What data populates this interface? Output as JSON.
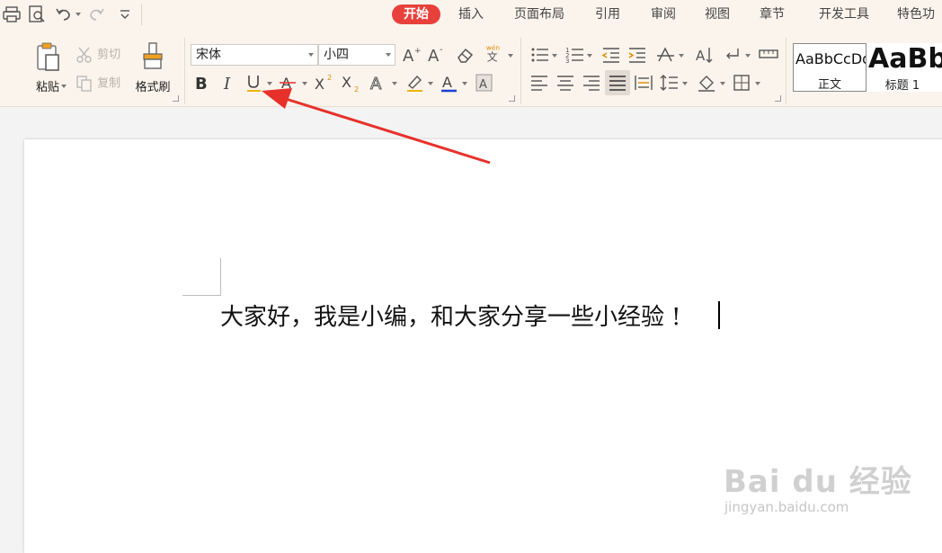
{
  "tabs": [
    {
      "label": "开始",
      "active": true
    },
    {
      "label": "插入"
    },
    {
      "label": "页面布局"
    },
    {
      "label": "引用"
    },
    {
      "label": "审阅"
    },
    {
      "label": "视图"
    },
    {
      "label": "章节"
    },
    {
      "label": "开发工具"
    },
    {
      "label": "特色功"
    }
  ],
  "clipboard": {
    "paste_label": "粘贴",
    "cut_label": "剪切",
    "copy_label": "复制",
    "format_painter_label": "格式刷"
  },
  "font": {
    "family_value": "宋体",
    "size_value": "小四"
  },
  "styles": {
    "normal_preview": "AaBbCcDd",
    "normal_name": "正文",
    "heading1_preview": "AaBb",
    "heading1_name": "标题 1"
  },
  "phonetic_glyph": "wén",
  "document": {
    "body_text": "大家好，我是小编，和大家分享一些小经验",
    "trailing_text": "!"
  },
  "watermark": {
    "logo_text": "Bai du 经验",
    "url_text": "jingyan.baidu.com"
  },
  "colors": {
    "active_tab": "#e8413b",
    "ribbon_bg": "#fbf4ec",
    "arrow": "#e8302a",
    "underline_accent": "#f0b400",
    "font_color_bar": "#1a3fd6"
  }
}
